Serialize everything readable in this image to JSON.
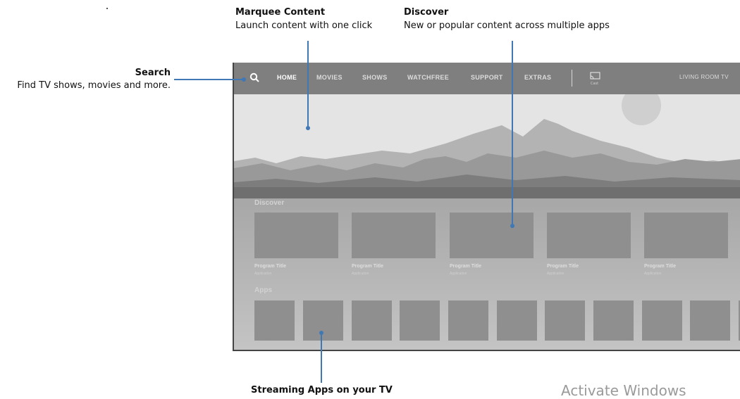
{
  "annotations": {
    "marquee": {
      "title": "Marquee Content",
      "subtitle": "Launch content with one click"
    },
    "discover": {
      "title": "Discover",
      "subtitle": "New or popular content across multiple apps"
    },
    "search": {
      "title": "Search",
      "subtitle": "Find TV shows, movies and more."
    },
    "apps": {
      "title": "Streaming Apps on your TV"
    }
  },
  "nav": {
    "items": [
      "HOME",
      "MOVIES",
      "SHOWS",
      "WATCHFREE",
      "SUPPORT",
      "EXTRAS"
    ],
    "active": "HOME",
    "cast_label": "Cast",
    "device_label": "LIVING ROOM TV"
  },
  "sections": {
    "discover_label": "Discover",
    "apps_label": "Apps"
  },
  "discover_cards": [
    {
      "title": "Program Title",
      "app": "Application"
    },
    {
      "title": "Program Title",
      "app": "Application"
    },
    {
      "title": "Program Title",
      "app": "Application"
    },
    {
      "title": "Program Title",
      "app": "Application"
    },
    {
      "title": "Program Title",
      "app": "Application"
    }
  ],
  "app_tile_count": 10,
  "watermark": "Activate Windows",
  "colors": {
    "accent_line": "#3f78b5",
    "navbar": "#7f7f7f",
    "tile": "#8f8f8f"
  }
}
